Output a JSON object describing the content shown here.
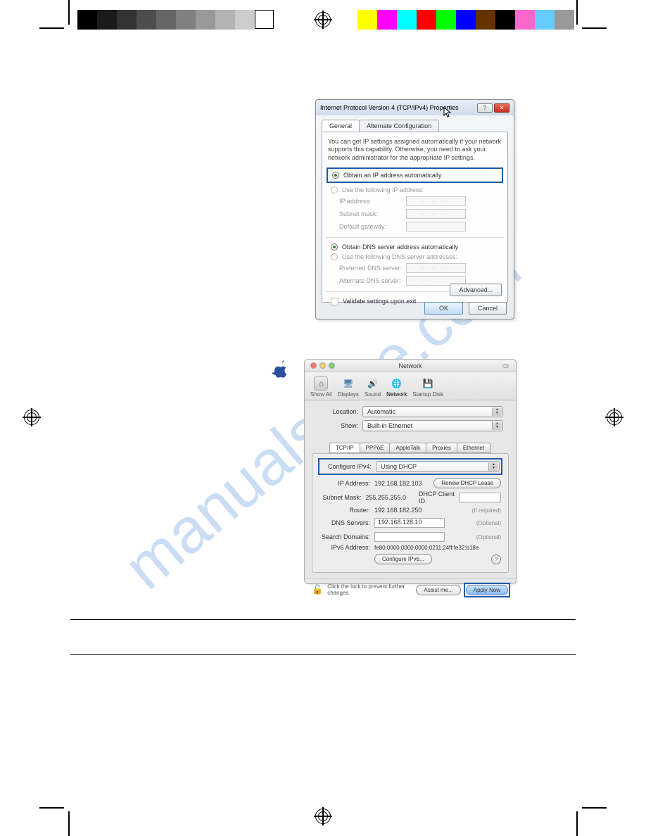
{
  "watermark": "manualshive.com",
  "win": {
    "title": "Internet Protocol Version 4 (TCP/IPv4) Properties",
    "tabs": {
      "general": "General",
      "alt": "Alternate Configuration"
    },
    "desc": "You can get IP settings assigned automatically if your network supports this capability. Otherwise, you need to ask your network administrator for the appropriate IP settings.",
    "radio_auto_ip": "Obtain an IP address automatically",
    "radio_manual_ip": "Use the following IP address:",
    "ip_address": "IP address:",
    "subnet": "Subnet mask:",
    "gateway": "Default gateway:",
    "dots": ".   .   .",
    "radio_auto_dns": "Obtain DNS server address automatically",
    "radio_manual_dns": "Use the following DNS server addresses:",
    "pref_dns": "Preferred DNS server:",
    "alt_dns": "Alternate DNS server:",
    "validate": "Validate settings upon exit",
    "advanced": "Advanced...",
    "ok": "OK",
    "cancel": "Cancel",
    "help": "?",
    "close": "✕"
  },
  "mac": {
    "title": "Network",
    "toolbar": {
      "showall": "Show All",
      "displays": "Displays",
      "sound": "Sound",
      "network": "Network",
      "startup": "Startup Disk"
    },
    "location_lbl": "Location:",
    "location_val": "Automatic",
    "show_lbl": "Show:",
    "show_val": "Built-in Ethernet",
    "tabs": {
      "tcpip": "TCP/IP",
      "pppoe": "PPPoE",
      "appletalk": "AppleTalk",
      "proxies": "Proxies",
      "ethernet": "Ethernet"
    },
    "cfg_lbl": "Configure IPv4:",
    "cfg_val": "Using DHCP",
    "ip_lbl": "IP Address:",
    "ip_val": "192.168.182.103",
    "renew": "Renew DHCP Lease",
    "subnet_lbl": "Subnet Mask:",
    "subnet_val": "255.255.255.0",
    "dhcp_id_lbl": "DHCP Client ID:",
    "if_required": "(If required)",
    "router_lbl": "Router:",
    "router_val": "192.168.182.250",
    "dns_lbl": "DNS Servers:",
    "dns_val": "192.168.128.10",
    "optional": "(Optional)",
    "search_lbl": "Search Domains:",
    "ipv6_lbl": "IPv6 Address:",
    "ipv6_val": "fe80:0000:0000:0000:0211:24ff:fe32:b18e",
    "cfg6": "Configure IPv6...",
    "help": "?",
    "lock_text": "Click the lock to prevent further changes.",
    "assist": "Assist me...",
    "apply": "Apply Now"
  },
  "colors": {
    "gray": [
      "#000000",
      "#1a1a1a",
      "#333333",
      "#4d4d4d",
      "#666666",
      "#808080",
      "#999999",
      "#b3b3b3",
      "#cccccc",
      "#ffffff"
    ],
    "process": [
      "#ffff00",
      "#ff00ff",
      "#00ffff",
      "#ff0000",
      "#00ff00",
      "#0000ff",
      "#663300",
      "#000000",
      "#ff66cc",
      "#66ccff",
      "#999999"
    ]
  }
}
